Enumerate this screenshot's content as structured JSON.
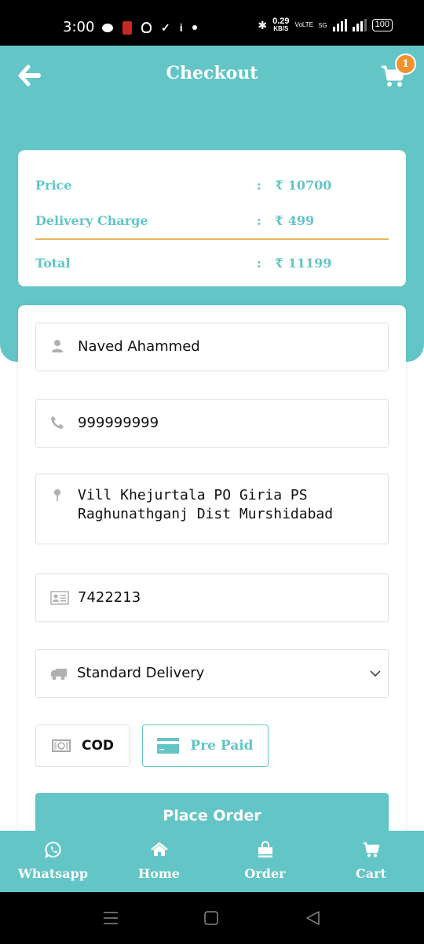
{
  "status_bar": {
    "time": "3:00",
    "speed_value": "0.29",
    "speed_unit": "KB/S",
    "network_label": "VoLTE",
    "network_type": "5G",
    "battery": "100"
  },
  "header": {
    "title": "Checkout",
    "cart_count": "1"
  },
  "summary": {
    "rows": [
      {
        "label": "Price",
        "separator": ":",
        "value": "₹ 10700"
      },
      {
        "label": "Delivery Charge",
        "separator": ":",
        "value": "₹ 499"
      },
      {
        "label": "Total",
        "separator": ":",
        "value": "₹ 11199"
      }
    ]
  },
  "form": {
    "name": {
      "icon": "user-icon",
      "value": "Naved Ahammed"
    },
    "phone": {
      "icon": "phone-icon",
      "value": "999999999"
    },
    "address": {
      "icon": "map-pin-icon",
      "value": "Vill Khejurtala PO Giria PS\nRaghunathganj Dist Murshidabad"
    },
    "pincode": {
      "icon": "id-card-icon",
      "value": "7422213"
    },
    "delivery": {
      "icon": "truck-icon",
      "selected": "Standard Delivery"
    },
    "payment": {
      "options": [
        {
          "label": "COD",
          "icon": "cash-icon",
          "selected": false
        },
        {
          "label": "Pre Paid",
          "icon": "credit-card-icon",
          "selected": true
        }
      ]
    },
    "submit_label": "Place Order"
  },
  "bottom_nav": {
    "items": [
      {
        "label": "Whatsapp",
        "icon": "whatsapp-icon"
      },
      {
        "label": "Home",
        "icon": "home-icon"
      },
      {
        "label": "Order",
        "icon": "shopping-bag-icon"
      },
      {
        "label": "Cart",
        "icon": "cart-icon"
      }
    ]
  },
  "colors": {
    "brand": "#63c5c6",
    "badge": "#f0902e",
    "divider": "#e8b85a"
  }
}
